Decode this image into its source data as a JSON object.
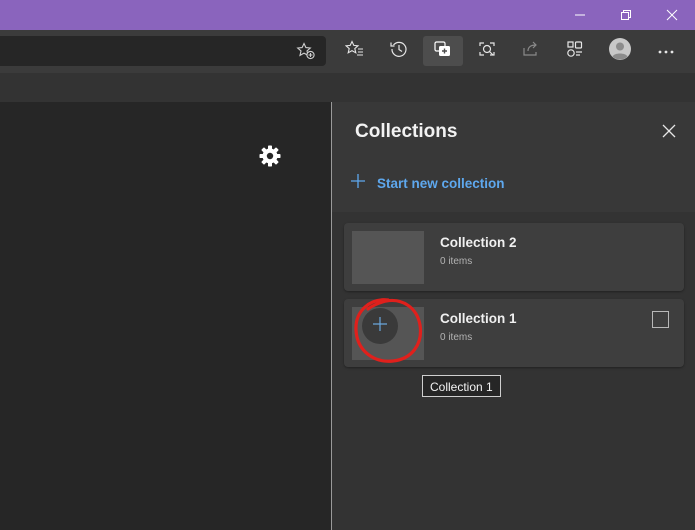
{
  "theme": {
    "titlebar": "#8a64bd",
    "accent": "#5ea8ee",
    "annotation": "#e0201c"
  },
  "window": {
    "controls": [
      {
        "name": "minimize-icon"
      },
      {
        "name": "restore-icon"
      },
      {
        "name": "close-icon"
      }
    ]
  },
  "toolbar": {
    "address_icons": [
      "add-favorite-icon"
    ],
    "buttons": [
      {
        "name": "favorites-icon"
      },
      {
        "name": "history-icon"
      },
      {
        "name": "collections-icon",
        "active": true
      },
      {
        "name": "web-capture-icon"
      },
      {
        "name": "share-icon"
      },
      {
        "name": "extensions-icon"
      },
      {
        "name": "profile-avatar"
      },
      {
        "name": "more-menu-icon"
      }
    ]
  },
  "content": {
    "icon": "gear-icon"
  },
  "collections_panel": {
    "title": "Collections",
    "new_collection_label": "Start new collection",
    "items": [
      {
        "title": "Collection 2",
        "count": "0 items"
      },
      {
        "title": "Collection 1",
        "count": "0 items"
      }
    ],
    "tooltip": "Collection 1"
  }
}
